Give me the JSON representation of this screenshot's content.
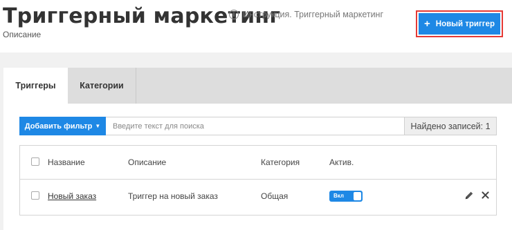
{
  "header": {
    "title": "Триггерный маркетинг",
    "help_link": "Инструкция. Триггерный маркетинг",
    "subtitle": "Описание",
    "new_trigger_label": "Новый триггер"
  },
  "tabs": [
    {
      "label": "Триггеры",
      "active": true
    },
    {
      "label": "Категории",
      "active": false
    }
  ],
  "filter": {
    "add_filter_label": "Добавить фильтр",
    "search_placeholder": "Введите текст для поиска",
    "records_found": "Найдено записей: 1"
  },
  "table": {
    "columns": [
      "Название",
      "Описание",
      "Категория",
      "Актив."
    ],
    "rows": [
      {
        "name": "Новый заказ",
        "description": "Триггер на новый заказ",
        "category": "Общая",
        "active_label": "Вкл",
        "active": true
      }
    ]
  },
  "colors": {
    "accent": "#1e88e5",
    "highlight_border": "#e53935"
  }
}
